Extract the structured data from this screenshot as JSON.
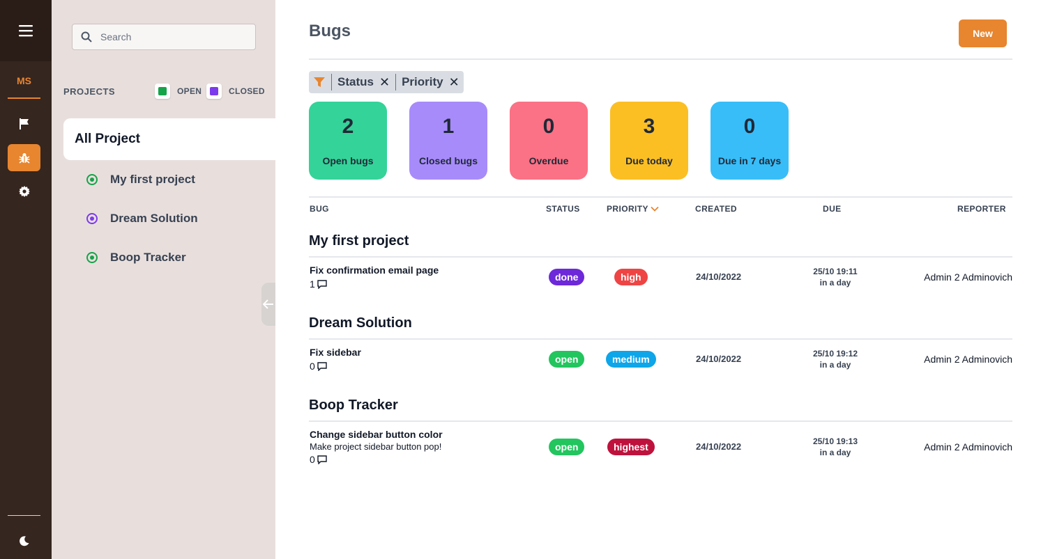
{
  "rail": {
    "user_initials": "MS",
    "icons": [
      "menu-icon",
      "flag-icon",
      "bug-icon",
      "gear-icon",
      "moon-icon"
    ]
  },
  "sidebar": {
    "search_placeholder": "Search",
    "projects_label": "PROJECTS",
    "legend": [
      {
        "label": "OPEN",
        "color": "#16a34a"
      },
      {
        "label": "CLOSED",
        "color": "#7c3aed"
      }
    ],
    "all_project": "All Project",
    "projects": [
      {
        "name": "My first project",
        "color": "#16a34a"
      },
      {
        "name": "Dream Solution",
        "color": "#7c3aed"
      },
      {
        "name": "Boop Tracker",
        "color": "#16a34a"
      }
    ]
  },
  "header": {
    "title": "Bugs",
    "new_label": "New"
  },
  "filters": [
    "Status",
    "Priority"
  ],
  "stats": [
    {
      "value": "2",
      "label": "Open bugs",
      "color": "#34d399"
    },
    {
      "value": "1",
      "label": "Closed bugs",
      "color": "#a78bfa"
    },
    {
      "value": "0",
      "label": "Overdue",
      "color": "#fb7185"
    },
    {
      "value": "3",
      "label": "Due today",
      "color": "#fbbf24"
    },
    {
      "value": "0",
      "label": "Due in 7 days",
      "color": "#38bdf8"
    }
  ],
  "columns": {
    "bug": "BUG",
    "status": "STATUS",
    "priority": "PRIORITY",
    "created": "CREATED",
    "due": "DUE",
    "reporter": "REPORTER"
  },
  "groups": [
    {
      "name": "My first project",
      "bugs": [
        {
          "title": "Fix confirmation email page",
          "description": "",
          "comments": "1",
          "status": "done",
          "priority": "high",
          "created": "24/10/2022",
          "due_date": "25/10 19:11",
          "due_relative": "in a day",
          "reporter": "Admin 2 Adminovich"
        }
      ]
    },
    {
      "name": "Dream Solution",
      "bugs": [
        {
          "title": "Fix sidebar",
          "description": "",
          "comments": "0",
          "status": "open",
          "priority": "medium",
          "created": "24/10/2022",
          "due_date": "25/10 19:12",
          "due_relative": "in a day",
          "reporter": "Admin 2 Adminovich"
        }
      ]
    },
    {
      "name": "Boop Tracker",
      "bugs": [
        {
          "title": "Change sidebar button color",
          "description": "Make project sidebar button pop!",
          "comments": "0",
          "status": "open",
          "priority": "highest",
          "created": "24/10/2022",
          "due_date": "25/10 19:13",
          "due_relative": "in a day",
          "reporter": "Admin 2 Adminovich"
        }
      ]
    }
  ],
  "colors": {
    "accent": "#e8852f",
    "status_done": "#6d28d9",
    "status_open": "#22c55e",
    "priority_high": "#ef4444",
    "priority_medium": "#0ea5e9",
    "priority_highest": "#be123c"
  }
}
